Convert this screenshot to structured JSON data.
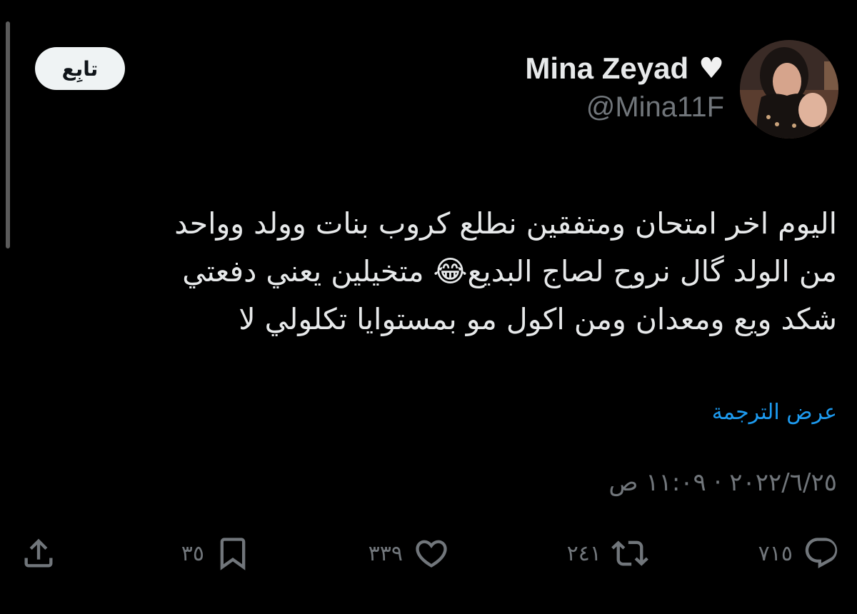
{
  "user": {
    "display_name": "Mina Zeyad",
    "handle": "@Mina11F"
  },
  "follow_button": {
    "label": "تابِع"
  },
  "tweet": {
    "lines": [
      "اليوم اخر امتحان ومتفقين نطلع كروب بنات وولد وواحد",
      "من الولد گال نروح لصاج البديع😂 متخيلين يعني دفعتي",
      "شكد ويع ومعدان ومن اكول مو بمستوايا تكلولي لا"
    ]
  },
  "translate_link": "عرض الترجمة",
  "timestamp": "٢٠٢٢/٦/٢٥ · ١١:٠٩ ص",
  "actions": {
    "reply": {
      "icon": "reply-icon",
      "count": "٧١٥"
    },
    "retweet": {
      "icon": "retweet-icon",
      "count": "٢٤١"
    },
    "like": {
      "icon": "heart-icon",
      "count": "٣٣٩"
    },
    "bookmark": {
      "icon": "bookmark-icon",
      "count": "٣٥"
    },
    "share": {
      "icon": "share-icon"
    }
  },
  "colors": {
    "background": "#000000",
    "text": "#e7e9ea",
    "muted": "#71767b",
    "link": "#1d9bf0",
    "follow_bg": "#eff3f4"
  }
}
